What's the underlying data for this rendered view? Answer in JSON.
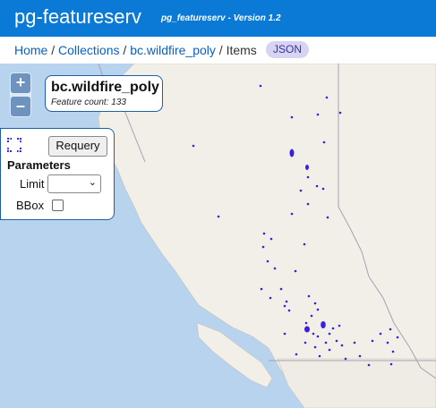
{
  "header": {
    "app_title": "pg-featureserv",
    "subtitle": "pg_featureserv - Version 1.2"
  },
  "breadcrumb": {
    "home": "Home",
    "sep1": " / ",
    "collections": "Collections",
    "sep2": " / ",
    "collection": "bc.wildfire_poly",
    "sep3": " / ",
    "current": "Items",
    "json_label": "JSON"
  },
  "map": {
    "zoom_in": "+",
    "zoom_out": "–",
    "colors": {
      "water": "#b7d3ee",
      "land": "#f2efe9",
      "feature": "#3b1fe0"
    }
  },
  "layer": {
    "name": "bc.wildfire_poly",
    "count_text": "Feature count: 133"
  },
  "params": {
    "requery_label": "Requery",
    "title": "Parameters",
    "limit_label": "Limit",
    "limit_value": "",
    "bbox_label": "BBox",
    "bbox_checked": false
  }
}
